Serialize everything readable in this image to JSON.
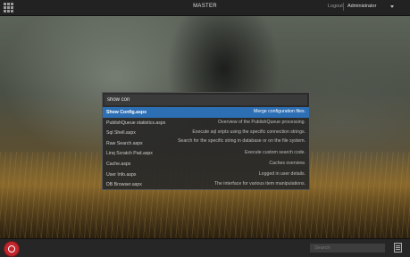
{
  "topbar": {
    "title": "MASTER",
    "logout": "Logout",
    "user": "Administrator"
  },
  "search": {
    "query": "show con"
  },
  "results": [
    {
      "name": "Show Config.aspx",
      "desc": "Merge configuration files.",
      "selected": true
    },
    {
      "name": "PublishQueue statistics.aspx",
      "desc": "Overview of the PublishQueue processing."
    },
    {
      "name": "Sql Shell.aspx",
      "desc": "Execute sql sripts using the specific connection strings."
    },
    {
      "name": "Raw Search.aspx",
      "desc": "Search for the specific string in database or on the file system."
    },
    {
      "name": "Linq Scratch Pad.aspx",
      "desc": "Execute custom search code."
    },
    {
      "name": "Cache.aspx",
      "desc": "Caches overview."
    },
    {
      "name": "User Info.aspx",
      "desc": "Logged in user details."
    },
    {
      "name": "DB Browser.aspx",
      "desc": "The interface for various item manipulations."
    }
  ],
  "taskbar": {
    "search_placeholder": "Search"
  },
  "colors": {
    "selection": "#2d6fb4",
    "start_button": "#c0272d"
  },
  "icons": [
    "app-grid-icon",
    "caret-down-icon",
    "start-menu-icon",
    "document-list-icon"
  ]
}
